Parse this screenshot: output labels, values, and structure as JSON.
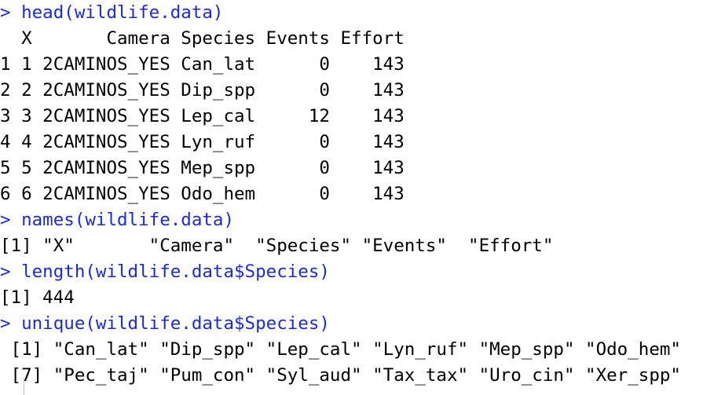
{
  "lines": [
    {
      "type": "cmd",
      "text": "> head(wildlife.data)"
    },
    {
      "type": "out",
      "text": "  X       Camera Species Events Effort"
    },
    {
      "type": "out",
      "text": "1 1 2CAMINOS_YES Can_lat      0    143"
    },
    {
      "type": "out",
      "text": "2 2 2CAMINOS_YES Dip_spp      0    143"
    },
    {
      "type": "out",
      "text": "3 3 2CAMINOS_YES Lep_cal     12    143"
    },
    {
      "type": "out",
      "text": "4 4 2CAMINOS_YES Lyn_ruf      0    143"
    },
    {
      "type": "out",
      "text": "5 5 2CAMINOS_YES Mep_spp      0    143"
    },
    {
      "type": "out",
      "text": "6 6 2CAMINOS_YES Odo_hem      0    143"
    },
    {
      "type": "cmd",
      "text": "> names(wildlife.data)"
    },
    {
      "type": "out",
      "text": "[1] \"X\"       \"Camera\"  \"Species\" \"Events\"  \"Effort\""
    },
    {
      "type": "cmd",
      "text": "> length(wildlife.data$Species)"
    },
    {
      "type": "out",
      "text": "[1] 444"
    },
    {
      "type": "cmd",
      "text": "> unique(wildlife.data$Species)"
    },
    {
      "type": "out",
      "text": " [1] \"Can_lat\" \"Dip_spp\" \"Lep_cal\" \"Lyn_ruf\" \"Mep_spp\" \"Odo_hem\""
    },
    {
      "type": "out",
      "text": " [7] \"Pec_taj\" \"Pum_con\" \"Syl_aud\" \"Tax_tax\" \"Uro_cin\" \"Xer_spp\""
    }
  ],
  "colors": {
    "command": "#1a2bd6",
    "output": "#000000",
    "background": "#ffffff"
  }
}
